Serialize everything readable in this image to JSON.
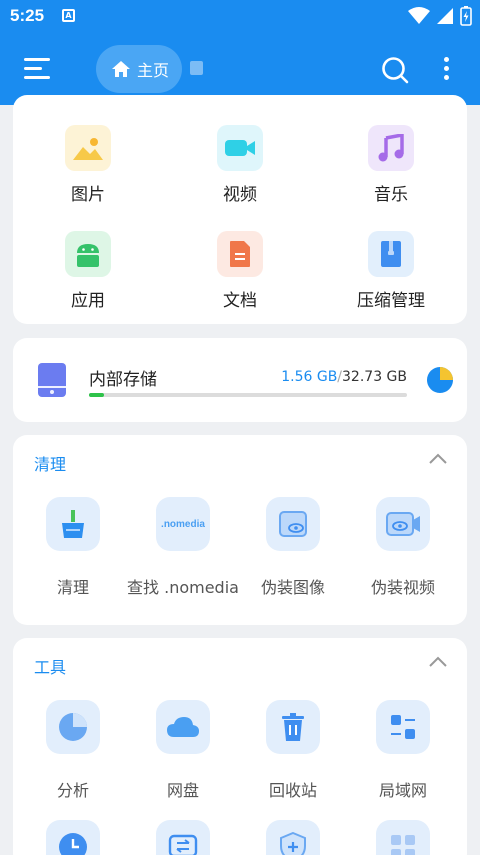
{
  "status_bar": {
    "time": "5:25",
    "notification_letter": "A"
  },
  "app_bar": {
    "home_label": "主页"
  },
  "categories": [
    {
      "label": "图片",
      "icon": "image-icon"
    },
    {
      "label": "视频",
      "icon": "video-icon"
    },
    {
      "label": "音乐",
      "icon": "music-icon"
    },
    {
      "label": "应用",
      "icon": "android-icon"
    },
    {
      "label": "文档",
      "icon": "document-icon"
    },
    {
      "label": "压缩管理",
      "icon": "archive-icon"
    }
  ],
  "storage": {
    "title": "内部存储",
    "used": "1.56 GB",
    "separator": "/",
    "total": "32.73 GB",
    "used_fraction": 0.048
  },
  "clean_section": {
    "title": "清理",
    "items": [
      {
        "label": "清理",
        "icon": "broom-icon"
      },
      {
        "label": "查找 .nomedia",
        "icon": "nomedia-icon",
        "icon_text": ".nomedia"
      },
      {
        "label": "伪装图像",
        "icon": "disguise-image-icon"
      },
      {
        "label": "伪装视频",
        "icon": "disguise-video-icon"
      }
    ]
  },
  "tools_section": {
    "title": "工具",
    "items": [
      {
        "label": "分析",
        "icon": "pie-chart-icon"
      },
      {
        "label": "网盘",
        "icon": "cloud-icon"
      },
      {
        "label": "回收站",
        "icon": "trash-icon"
      },
      {
        "label": "局域网",
        "icon": "lan-icon"
      }
    ]
  },
  "colors": {
    "primary": "#1a8cf0",
    "background": "#eef0f3",
    "progress": "#2ec24a"
  }
}
